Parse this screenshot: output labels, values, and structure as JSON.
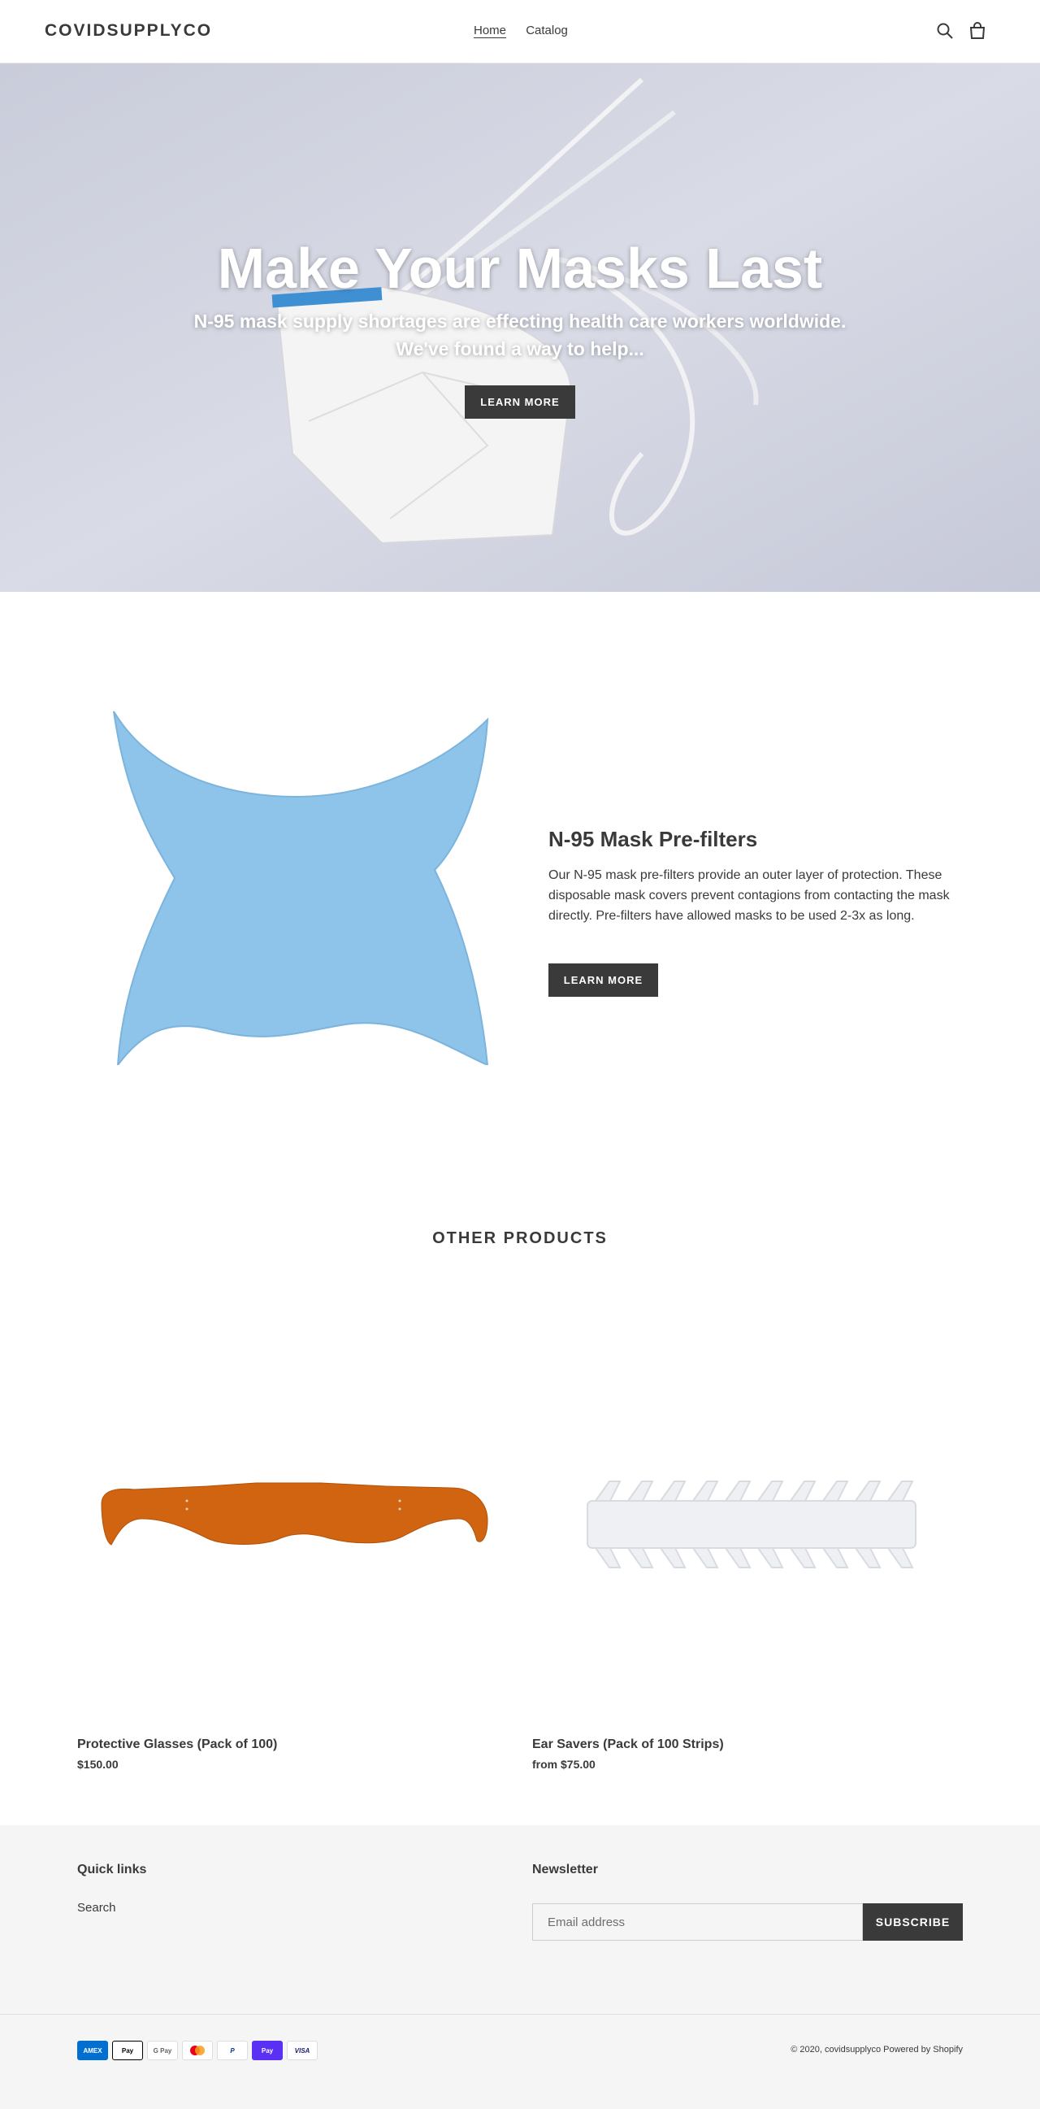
{
  "header": {
    "logo": "COVIDSUPPLYCO",
    "nav": [
      {
        "label": "Home",
        "active": true
      },
      {
        "label": "Catalog",
        "active": false
      }
    ],
    "icons": [
      "search-icon",
      "cart-icon"
    ]
  },
  "hero": {
    "title": "Make Your Masks Last",
    "subtitle_line1": "N-95 mask supply shortages are effecting health care workers worldwide.",
    "subtitle_line2": "We've found a way to help...",
    "button": "LEARN MORE"
  },
  "feature": {
    "title": "N-95 Mask Pre-filters",
    "description": "Our N-95 mask pre-filters provide an outer layer of protection. These disposable mask covers prevent contagions from contacting the mask directly.  Pre-filters have allowed masks to be used 2-3x as long.",
    "button": "LEARN MORE"
  },
  "products": {
    "title": "OTHER PRODUCTS",
    "items": [
      {
        "name": "Protective Glasses (Pack of 100)",
        "price": "$150.00"
      },
      {
        "name": "Ear Savers (Pack of 100 Strips)",
        "price": "from $75.00"
      }
    ]
  },
  "footer": {
    "quick_links_title": "Quick links",
    "links": [
      "Search"
    ],
    "newsletter_title": "Newsletter",
    "email_placeholder": "Email address",
    "subscribe": "SUBSCRIBE",
    "payment_methods": [
      {
        "label": "AMEX",
        "bg": "#016fd0",
        "color": "#ffffff"
      },
      {
        "label": "Pay",
        "bg": "#ffffff",
        "color": "#000000"
      },
      {
        "label": "G Pay",
        "bg": "#ffffff",
        "color": "#5f6368"
      },
      {
        "label": "",
        "bg": "#ffffff",
        "color": "#eb001b"
      },
      {
        "label": "P",
        "bg": "#ffffff",
        "color": "#003087"
      },
      {
        "label": "Pay",
        "bg": "#5a31f4",
        "color": "#ffffff"
      },
      {
        "label": "VISA",
        "bg": "#ffffff",
        "color": "#1a1f71"
      }
    ],
    "copyright": "© 2020, covidsupplyco Powered by Shopify"
  }
}
